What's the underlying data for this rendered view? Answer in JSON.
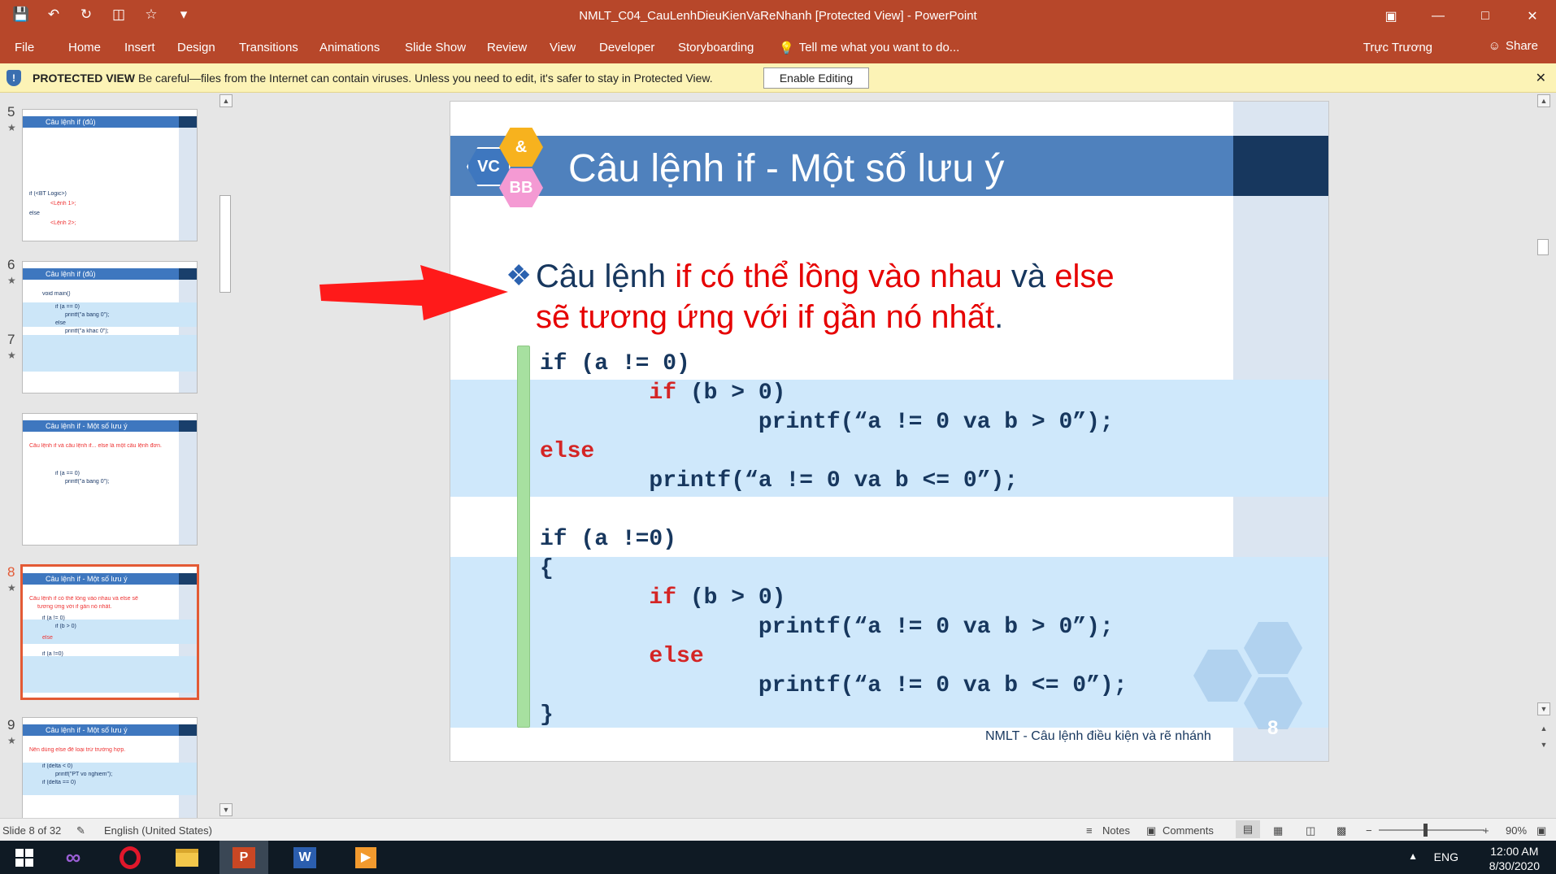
{
  "window": {
    "title": "NMLT_C04_CauLenhDieuKienVaReNhanh [Protected View] - PowerPoint",
    "controls": [
      "restore-ribbon-icon",
      "minimize-icon",
      "maximize-icon",
      "close-icon"
    ]
  },
  "qat": [
    "save-icon",
    "undo-icon",
    "redo-icon",
    "slideshow-icon",
    "star-icon",
    "customize-icon"
  ],
  "ribbon": {
    "tabs": [
      "File",
      "Home",
      "Insert",
      "Design",
      "Transitions",
      "Animations",
      "Slide Show",
      "Review",
      "View",
      "Developer",
      "Storyboarding"
    ],
    "tell_me": "Tell me what you want to do...",
    "user": "Trực Trương",
    "share": "Share"
  },
  "protected": {
    "title": "PROTECTED VIEW",
    "message": "Be careful—files from the Internet can contain viruses. Unless you need to edit, it's safer to stay in Protected View.",
    "button": "Enable Editing"
  },
  "thumbnails": [
    {
      "num": "5",
      "title": "Câu lệnh if (đủ)",
      "lines": [
        "if (<BT Logic>)",
        "<Lệnh 1>;",
        "else",
        "<Lệnh 2>;"
      ]
    },
    {
      "num": "6",
      "title": "Câu lệnh if (đủ)",
      "lines": [
        "void main()",
        "if (a == 0)",
        "printf(\"a bang 0\");",
        "else",
        "printf(\"a khac 0\");"
      ]
    },
    {
      "num": "7",
      "title": "Câu lệnh if - Một số lưu ý",
      "lines": [
        "Câu lệnh if và câu lệnh if... else là một câu lệnh đơn.",
        "if (a == 0)",
        "printf(\"a bang 0\");"
      ]
    },
    {
      "num": "8",
      "title": "Câu lệnh if - Một số lưu ý",
      "lines": [
        "Câu lệnh if có thể lồng vào nhau và else sẽ",
        "tương ứng với if gần nó nhất.",
        "if (a != 0)",
        "if (b > 0)",
        "else",
        "if (a !=0)"
      ]
    },
    {
      "num": "9",
      "title": "Câu lệnh if - Một số lưu ý",
      "lines": [
        "Nên dùng else để loại trừ trường hợp.",
        "if (delta < 0)",
        "printf(\"PT vo nghiem\");",
        "if (delta == 0)"
      ]
    }
  ],
  "slide": {
    "logo": {
      "a": "VC",
      "b": "&",
      "c": "BB"
    },
    "title": "Câu lệnh if - Một số lưu ý",
    "bullet": {
      "p1": "Câu lệnh ",
      "r1": "if có thể lồng vào nhau",
      "p2": " và ",
      "r2": "else sẽ tương ứng với if gần nó nhất",
      "p3": "."
    },
    "code": [
      {
        "kw": "",
        "txt": "if (a != 0)"
      },
      {
        "kw": "        if",
        "txt": " (b > 0)"
      },
      {
        "kw": "",
        "txt": "                printf(“a != 0 va b > 0”);"
      },
      {
        "kw": "else",
        "txt": ""
      },
      {
        "kw": "",
        "txt": "        printf(“a != 0 va b <= 0”);"
      },
      {
        "kw": "",
        "txt": ""
      },
      {
        "kw": "",
        "txt": "if (a !=0)"
      },
      {
        "kw": "",
        "txt": "{"
      },
      {
        "kw": "        if",
        "txt": " (b > 0)"
      },
      {
        "kw": "",
        "txt": "                printf(“a != 0 va b > 0”);"
      },
      {
        "kw": "        else",
        "txt": ""
      },
      {
        "kw": "",
        "txt": "                printf(“a != 0 va b <= 0”);"
      },
      {
        "kw": "",
        "txt": "}"
      }
    ],
    "footer": "NMLT - Câu lệnh điều kiện và rẽ nhánh",
    "number": "8"
  },
  "status": {
    "slide": "Slide 8 of 32",
    "language": "English (United States)",
    "notes": "Notes",
    "comments": "Comments",
    "zoom": "90%"
  },
  "taskbar": {
    "apps": [
      "windows-start-icon",
      "visual-studio-icon",
      "opera-icon",
      "file-explorer-icon",
      "powerpoint-icon",
      "word-icon",
      "media-player-icon"
    ],
    "lang": "ENG",
    "time": "12:00 AM",
    "date": "8/30/2020"
  },
  "colors": {
    "accent": "#b7472a",
    "slide_band": "#4f81bd",
    "code_red": "#d42525",
    "text_red": "#e60000"
  }
}
